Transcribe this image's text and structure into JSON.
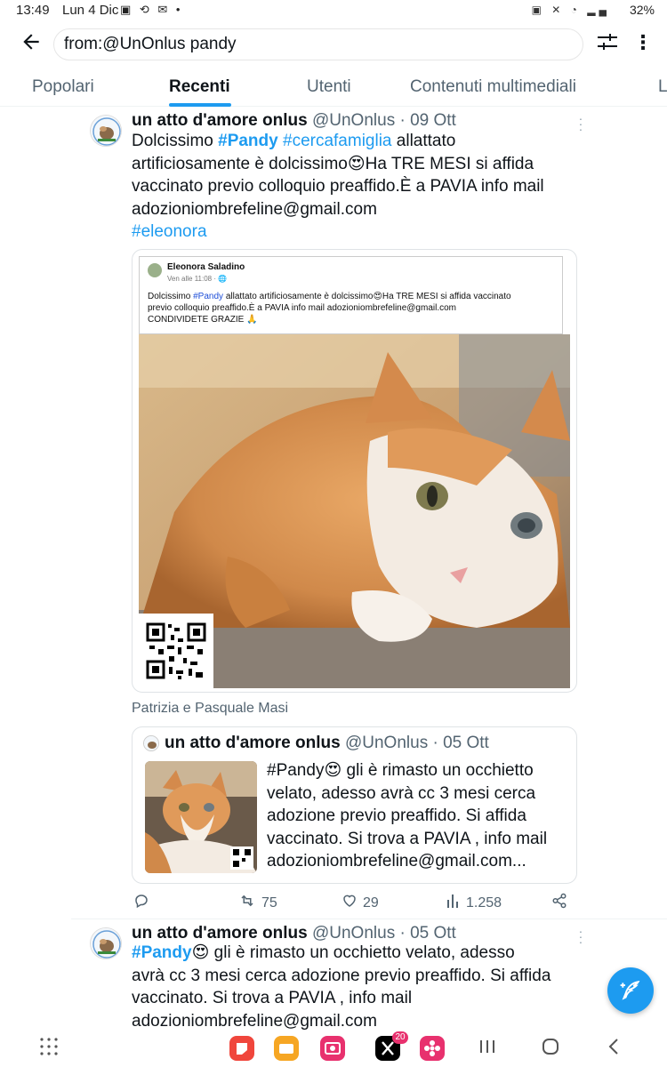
{
  "status": {
    "time": "13:49",
    "date": "Lun 4 Dic",
    "notif_icons": "▣ ⟲ ✉ •",
    "right_icons": "▣ ✕ ◔ ▂▄",
    "battery": "32%"
  },
  "search": {
    "query": "from:@UnOnlus pandy"
  },
  "tabs": [
    {
      "label": "Popolari"
    },
    {
      "label": "Recenti"
    },
    {
      "label": "Utenti"
    },
    {
      "label": "Contenuti multimediali"
    },
    {
      "label": "L"
    }
  ],
  "tweet1": {
    "name": "un atto d'amore onlus",
    "handle": "@UnOnlus",
    "date": "· 09 Ott",
    "text_parts": {
      "p1": "Dolcissimo ",
      "h1": "#Pandy",
      "h2": "#cercafamiglia",
      "p2": " allattato",
      "line2": "artificiosamente è dolcissimo😍Ha TRE MESI  si affida",
      "line3": "vaccinato previo colloquio preaffido.È a PAVIA info mail",
      "line4": "adozioniombrefeline@gmail.com",
      "h3": "#eleonora"
    },
    "media": {
      "fb_author": "Eleonora Saladino",
      "fb_time": "Ven alle 11:08 · 🌐",
      "fb_text_1a": "Dolcissimo ",
      "fb_text_1b": "#Pandy",
      "fb_text_1c": " allattato artificiosamente è dolcissimo😍Ha TRE MESI  si affida vaccinato",
      "fb_text_2": "previo colloquio preaffido.È a PAVIA info mail adozioniombrefeline@gmail.com",
      "fb_text_3": "CONDIVIDETE GRAZIE 🙏"
    },
    "tagged": "Patrizia e Pasquale Masi",
    "quote": {
      "name": "un atto d'amore onlus",
      "handle": "@UnOnlus",
      "date": "· 05 Ott",
      "line1": "#Pandy😍   gli è rimasto un occhietto",
      "line2": "velato, adesso avrà cc 3 mesi cerca",
      "line3": "adozione previo preaffido. Si affida",
      "line4": "vaccinato. Si trova a PAVIA , info mail",
      "line5": "adozioniombrefeline@gmail.com..."
    },
    "stats": {
      "retweets": "75",
      "likes": "29",
      "views": "1.258"
    }
  },
  "tweet2": {
    "name": "un atto d'amore onlus",
    "handle": "@UnOnlus",
    "date": "· 05 Ott",
    "h1": "#Pandy",
    "line1_rest": "😍   gli è rimasto un occhietto velato, adesso",
    "line2": "avrà cc 3 mesi cerca adozione previo preaffido. Si affida",
    "line3": "vaccinato. Si trova a PAVIA , info mail",
    "line4": "adozioniombrefeline@gmail.com"
  },
  "notifications_badge": "20",
  "colors": {
    "accent": "#1d9bf0",
    "muted": "#536471",
    "text": "#0f1419"
  }
}
